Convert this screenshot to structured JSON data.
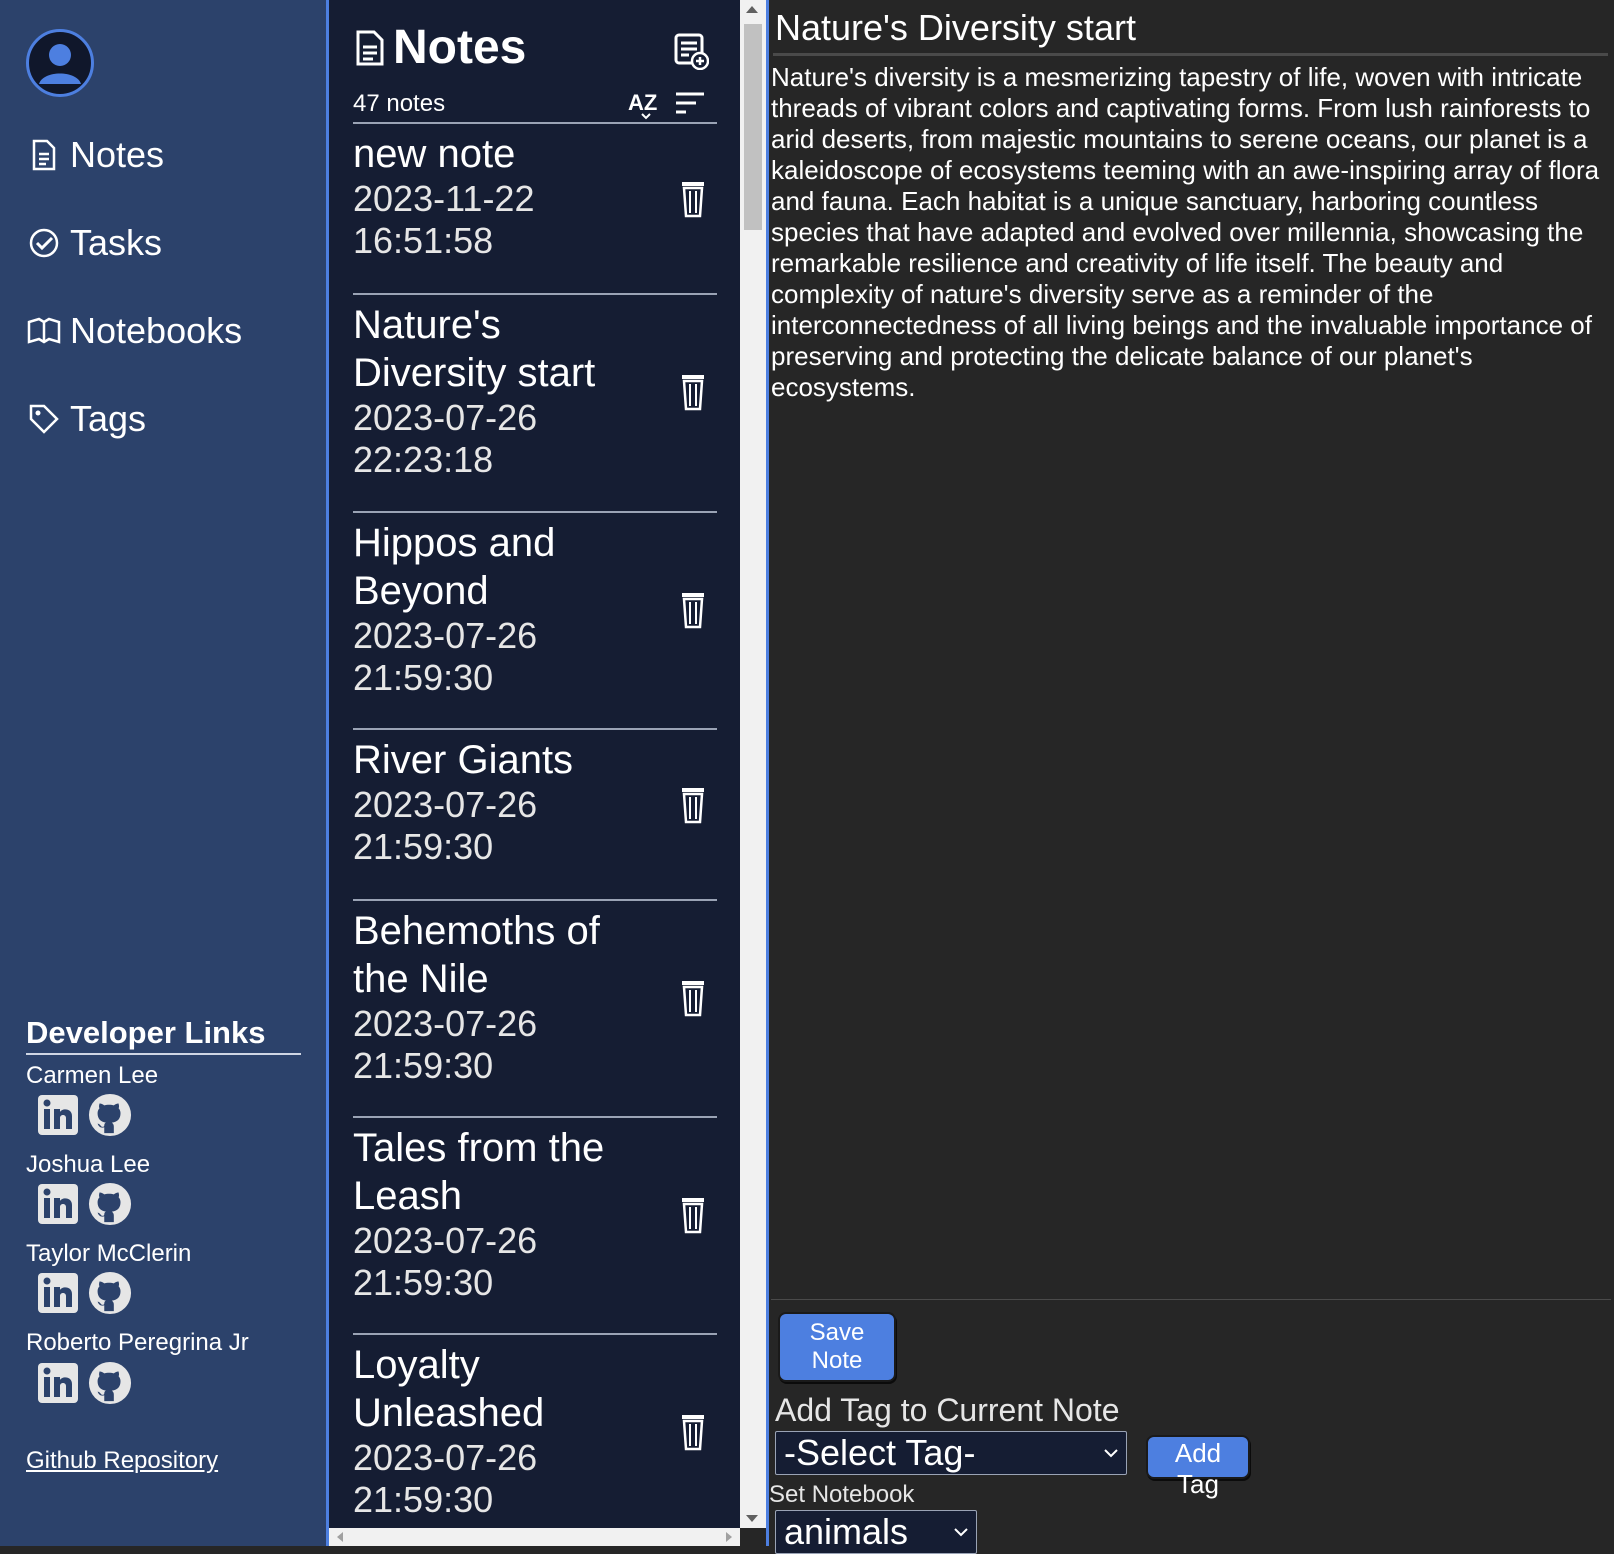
{
  "sidebar": {
    "nav": [
      {
        "label": "Notes",
        "icon": "document-icon"
      },
      {
        "label": "Tasks",
        "icon": "check-circle-icon"
      },
      {
        "label": "Notebooks",
        "icon": "open-book-icon"
      },
      {
        "label": "Tags",
        "icon": "tag-icon"
      }
    ],
    "developer_links_title": "Developer Links",
    "developers": [
      {
        "name": "Carmen Lee"
      },
      {
        "name": "Joshua Lee"
      },
      {
        "name": "Taylor McClerin"
      },
      {
        "name": "Roberto Peregrina Jr"
      }
    ],
    "repo_link": "Github Repository"
  },
  "note_list": {
    "title": "Notes",
    "count": "47 notes",
    "notes": [
      {
        "title": "new note",
        "date": "2023-11-22",
        "time": "16:51:58"
      },
      {
        "title": "Nature's Diversity start",
        "date": "2023-07-26",
        "time": "22:23:18"
      },
      {
        "title": "Hippos and Beyond",
        "date": "2023-07-26",
        "time": "21:59:30"
      },
      {
        "title": "River Giants",
        "date": "2023-07-26",
        "time": "21:59:30"
      },
      {
        "title": "Behemoths of the Nile",
        "date": "2023-07-26",
        "time": "21:59:30"
      },
      {
        "title": "Tales from the Leash",
        "date": "2023-07-26",
        "time": "21:59:30"
      },
      {
        "title": "Loyalty Unleashed",
        "date": "2023-07-26",
        "time": "21:59:30"
      }
    ]
  },
  "editor": {
    "title": "Nature's Diversity start",
    "body": "Nature's diversity is a mesmerizing tapestry of life, woven with intricate threads of vibrant colors and captivating forms. From lush rainforests to arid deserts, from majestic mountains to serene oceans, our planet is a kaleidoscope of ecosystems teeming with an awe-inspiring array of flora and fauna. Each habitat is a unique sanctuary, harboring countless species that have adapted and evolved over millennia, showcasing the remarkable resilience and creativity of life itself. The beauty and complexity of nature's diversity serve as a reminder of the interconnectedness of all living beings and the invaluable importance of preserving and protecting the delicate balance of our planet's ecosystems.",
    "save_label": "Save Note",
    "add_tag_label": "Add Tag to Current Note",
    "tag_select_value": "-Select Tag-",
    "add_tag_button": "Add Tag",
    "notebook_label": "Set Notebook",
    "notebook_select_value": "animals"
  },
  "colors": {
    "sidebar_bg": "#2c426b",
    "list_bg": "#151d33",
    "editor_bg": "#262626",
    "accent": "#4d7fe0"
  }
}
